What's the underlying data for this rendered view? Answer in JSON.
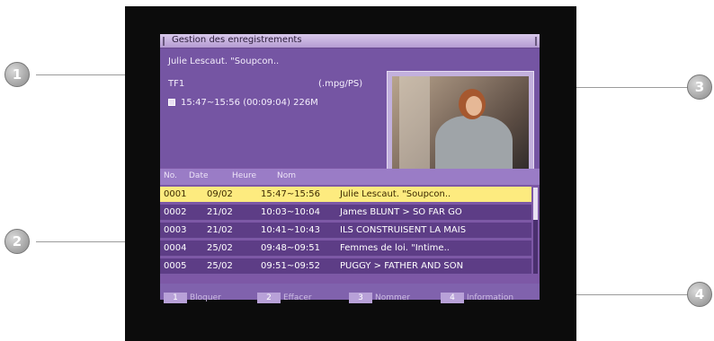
{
  "dialog": {
    "title": "Gestion des enregistrements",
    "info": {
      "program": "Julie Lescaut. \"Soupcon..",
      "channel": "TF1",
      "format": "(.mpg/PS)",
      "time_size": "15:47~15:56 (00:09:04) 226M"
    },
    "list": {
      "headers": [
        "No.",
        "Date",
        "Heure",
        "Nom"
      ],
      "rows": [
        {
          "no": "0001",
          "date": "09/02",
          "time": "15:47~15:56",
          "name": "Julie Lescaut. \"Soupcon..",
          "selected": true
        },
        {
          "no": "0002",
          "date": "21/02",
          "time": "10:03~10:04",
          "name": "James BLUNT > SO FAR GO",
          "selected": false
        },
        {
          "no": "0003",
          "date": "21/02",
          "time": "10:41~10:43",
          "name": "ILS CONSTRUISENT LA MAIS",
          "selected": false
        },
        {
          "no": "0004",
          "date": "25/02",
          "time": "09:48~09:51",
          "name": "Femmes de loi. \"Intime..",
          "selected": false
        },
        {
          "no": "0005",
          "date": "25/02",
          "time": "09:51~09:52",
          "name": "PUGGY > FATHER AND SON",
          "selected": false
        }
      ]
    },
    "footer": [
      {
        "num": "1",
        "label": "Bloquer"
      },
      {
        "num": "2",
        "label": "Effacer"
      },
      {
        "num": "3",
        "label": "Nommer"
      },
      {
        "num": "4",
        "label": "Information"
      }
    ]
  },
  "callouts": [
    "1",
    "2",
    "3",
    "4"
  ],
  "colors": {
    "panel": "#7d58a6",
    "row": "#5d3d86",
    "selected_row": "#fdeb7f",
    "title_bar": "#c9b4e2"
  }
}
